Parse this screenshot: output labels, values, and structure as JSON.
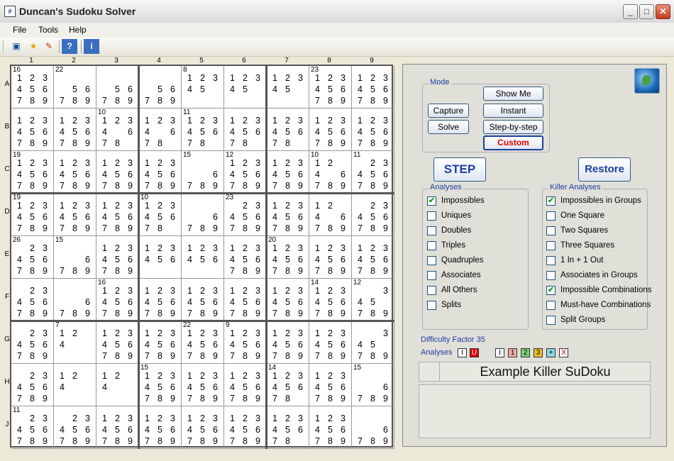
{
  "window": {
    "title": "Duncan's Sudoku Solver",
    "app_icon": "grid-icon"
  },
  "menu": [
    "File",
    "Tools",
    "Help"
  ],
  "toolbar": {
    "help_label": "?",
    "info_label": "i"
  },
  "grid": {
    "col_labels": [
      "1",
      "2",
      "3",
      "4",
      "5",
      "6",
      "7",
      "8",
      "9"
    ],
    "row_labels": [
      "A",
      "B",
      "C",
      "D",
      "E",
      "F",
      "G",
      "H",
      "J"
    ],
    "cage_totals": [
      {
        "row": 0,
        "col": 0,
        "text": "16"
      },
      {
        "row": 0,
        "col": 1,
        "text": "22"
      },
      {
        "row": 0,
        "col": 4,
        "text": "8"
      },
      {
        "row": 0,
        "col": 7,
        "text": "23"
      },
      {
        "row": 1,
        "col": 2,
        "text": "10"
      },
      {
        "row": 1,
        "col": 4,
        "text": "11"
      },
      {
        "row": 2,
        "col": 0,
        "text": "19"
      },
      {
        "row": 2,
        "col": 4,
        "text": "15"
      },
      {
        "row": 2,
        "col": 5,
        "text": "12"
      },
      {
        "row": 2,
        "col": 7,
        "text": "10"
      },
      {
        "row": 2,
        "col": 8,
        "text": "11"
      },
      {
        "row": 3,
        "col": 0,
        "text": "19"
      },
      {
        "row": 3,
        "col": 3,
        "text": "10"
      },
      {
        "row": 3,
        "col": 5,
        "text": "23"
      },
      {
        "row": 4,
        "col": 0,
        "text": "26"
      },
      {
        "row": 4,
        "col": 1,
        "text": "15"
      },
      {
        "row": 4,
        "col": 6,
        "text": "20"
      },
      {
        "row": 5,
        "col": 2,
        "text": "16"
      },
      {
        "row": 5,
        "col": 7,
        "text": "14"
      },
      {
        "row": 5,
        "col": 8,
        "text": "12"
      },
      {
        "row": 6,
        "col": 1,
        "text": "7"
      },
      {
        "row": 6,
        "col": 4,
        "text": "22"
      },
      {
        "row": 6,
        "col": 5,
        "text": "9"
      },
      {
        "row": 7,
        "col": 3,
        "text": "15"
      },
      {
        "row": 7,
        "col": 6,
        "text": "14"
      },
      {
        "row": 7,
        "col": 8,
        "text": "15"
      },
      {
        "row": 8,
        "col": 0,
        "text": "11"
      }
    ],
    "cells": [
      [
        "123456789",
        "56789",
        "56789",
        "56789",
        "12345",
        "12345",
        "12345",
        "123456789",
        "123456789"
      ],
      [
        "123456789",
        "123456789",
        "1234678",
        "1234678",
        "12345678",
        "12345678",
        "12345678",
        "123456789",
        "123456789"
      ],
      [
        "123456789",
        "123456789",
        "123456789",
        "123456789",
        "6789",
        "123456789",
        "123456789",
        "1246789",
        "23456789"
      ],
      [
        "123456789",
        "123456789",
        "123456789",
        "12345678",
        "6789",
        "23456789",
        "123456789",
        "1246789",
        "23456789"
      ],
      [
        "23456789",
        "6789",
        "123456789",
        "123456",
        "123456",
        "123456789",
        "123456789",
        "123456789",
        "123456789"
      ],
      [
        "23456789",
        "6789",
        "123456789",
        "123456789",
        "123456789",
        "123456789",
        "123456789",
        "123456789",
        "345789"
      ],
      [
        "23456789",
        "124",
        "123456789",
        "123456789",
        "123456789",
        "123456789",
        "123456789",
        "123456789",
        "345789"
      ],
      [
        "23456789",
        "124",
        "124",
        "123456789",
        "123456789",
        "123456789",
        "12345678",
        "123456789",
        "6789"
      ],
      [
        "23456789",
        "23456789",
        "123456789",
        "123456789",
        "123456789",
        "123456789",
        "12345678",
        "123456789",
        "6789"
      ]
    ]
  },
  "mode": {
    "title": "Mode",
    "capture": "Capture",
    "solve": "Solve",
    "show_me": "Show Me",
    "instant": "Instant",
    "step_by_step": "Step-by-step",
    "custom": "Custom"
  },
  "step_button": "STEP",
  "restore_button": "Restore",
  "analyses": {
    "title": "Analyses",
    "items": [
      {
        "label": "Impossibles",
        "checked": true
      },
      {
        "label": "Uniques",
        "checked": false
      },
      {
        "label": "Doubles",
        "checked": false
      },
      {
        "label": "Triples",
        "checked": false
      },
      {
        "label": "Quadruples",
        "checked": false
      },
      {
        "label": "Associates",
        "checked": false
      },
      {
        "label": "All Others",
        "checked": false
      },
      {
        "label": "Splits",
        "checked": false
      }
    ]
  },
  "killer_analyses": {
    "title": "Killer Analyses",
    "items": [
      {
        "label": "Impossibles in Groups",
        "checked": true
      },
      {
        "label": "One Square",
        "checked": false
      },
      {
        "label": "Two Squares",
        "checked": false
      },
      {
        "label": "Three Squares",
        "checked": false
      },
      {
        "label": "1 In + 1 Out",
        "checked": false
      },
      {
        "label": "Associates in Groups",
        "checked": false
      },
      {
        "label": "Impossible Combinations",
        "checked": true
      },
      {
        "label": "Must-have Combinations",
        "checked": false
      },
      {
        "label": "Split Groups",
        "checked": false
      }
    ]
  },
  "difficulty": "Difficulty Factor 35",
  "analyses_legend": {
    "label": "Analyses",
    "boxes": [
      {
        "text": "I",
        "bg": "#ffffff",
        "fg": "#000000"
      },
      {
        "text": "U",
        "bg": "#e00000",
        "fg": "#ffffff"
      },
      {
        "text": "I",
        "bg": "#ffffff",
        "fg": "#000000"
      },
      {
        "text": "1",
        "bg": "#f8a8a8",
        "fg": "#000000"
      },
      {
        "text": "2",
        "bg": "#7ed07e",
        "fg": "#000000"
      },
      {
        "text": "3",
        "bg": "#f0c020",
        "fg": "#000000"
      },
      {
        "text": "+",
        "bg": "#88d8e8",
        "fg": "#000000"
      },
      {
        "text": "X",
        "bg": "#ffffff",
        "fg": "#c00000"
      }
    ]
  },
  "puzzle_title": "Example Killer SuDoku",
  "colors": {
    "accent": "#1e3fa0",
    "highlight": "#e00000"
  }
}
